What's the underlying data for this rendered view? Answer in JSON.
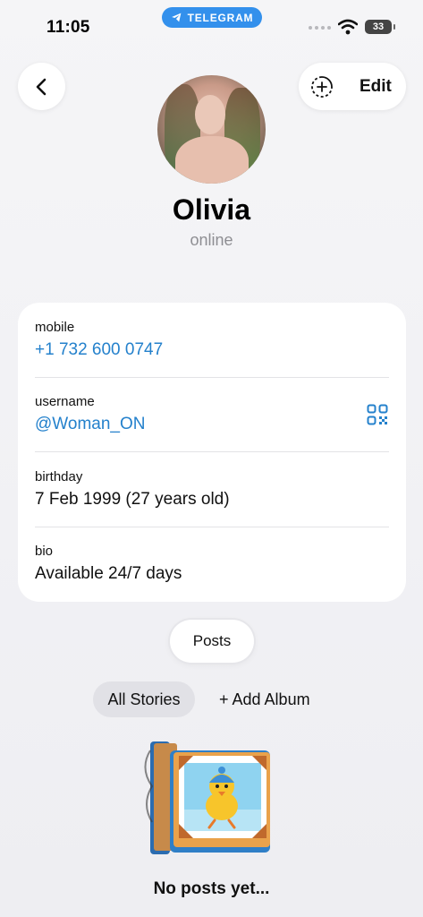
{
  "status_bar": {
    "time": "11:05",
    "app_pill": "TELEGRAM",
    "battery": "33"
  },
  "header": {
    "edit_label": "Edit"
  },
  "profile": {
    "name": "Olivia",
    "presence": "online"
  },
  "info": [
    {
      "label": "mobile",
      "value": "+1 732 600 0747",
      "is_link": true
    },
    {
      "label": "username",
      "value": "@Woman_ON",
      "is_link": true
    },
    {
      "label": "birthday",
      "value": "7 Feb 1999 (27 years old)",
      "is_link": false
    },
    {
      "label": "bio",
      "value": "Available 24/7 days",
      "is_link": false
    }
  ],
  "tabs": {
    "posts_label": "Posts"
  },
  "stories": {
    "all_stories_label": "All Stories",
    "add_album_label": "+ Add Album"
  },
  "empty_state": {
    "text": "No posts yet..."
  },
  "colors": {
    "accent": "#2481cc",
    "telegram_pill": "#3390ec",
    "secondary_text": "#8e8e93"
  }
}
